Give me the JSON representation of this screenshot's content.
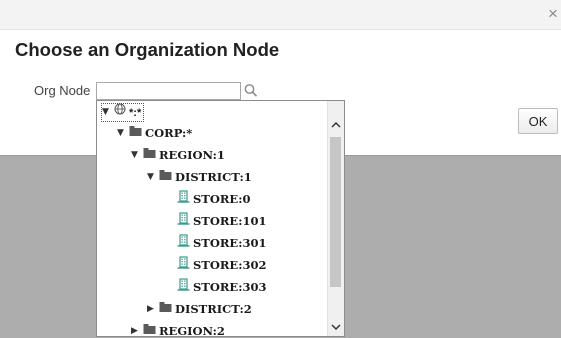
{
  "dialog": {
    "close_glyph": "×",
    "title": "Choose an Organization Node",
    "org_node_label": "Org Node",
    "org_node_value": "",
    "ok_label": "OK"
  },
  "tree": {
    "root": "*:*",
    "corp": "CORP:*",
    "region1": "REGION:1",
    "district1": "DISTRICT:1",
    "stores": [
      "STORE:0",
      "STORE:101",
      "STORE:301",
      "STORE:302",
      "STORE:303"
    ],
    "district2": "DISTRICT:2",
    "region2": "REGION:2",
    "expanded_glyph": "▼",
    "collapsed_glyph": "▶"
  },
  "icons": {
    "search": "search-icon",
    "globe": "globe-icon",
    "folder": "folder-icon",
    "store": "building-icon",
    "close": "close-icon"
  },
  "colors": {
    "modal_overlay": "#adadad",
    "store_icon": "#3a9a8a",
    "folder_icon": "#5a5a5a"
  }
}
